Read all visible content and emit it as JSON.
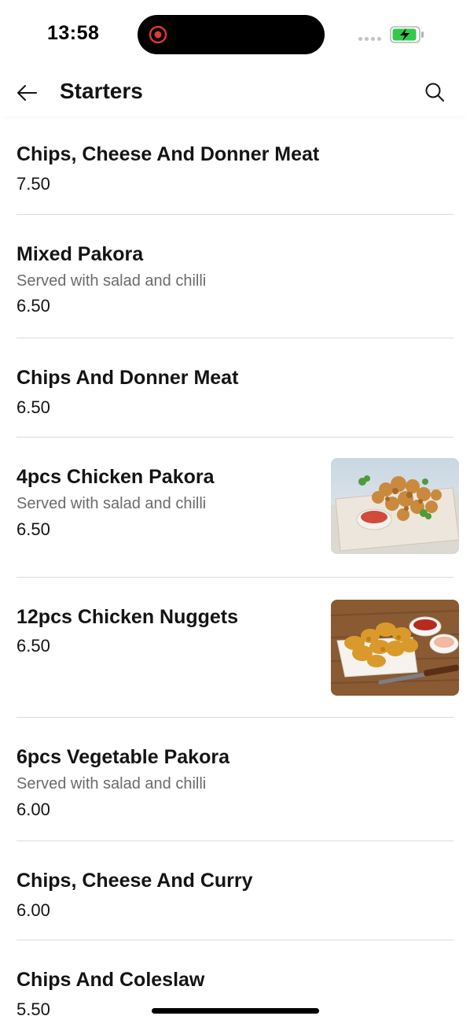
{
  "status_bar": {
    "time": "13:58"
  },
  "header": {
    "title": "Starters"
  },
  "colors": {
    "text": "#141414",
    "secondary_text": "#6b6b6b",
    "divider": "#dcdcdc",
    "battery_green": "#32c94c",
    "record_red": "#e03b2f"
  },
  "menu": {
    "items": [
      {
        "name": "Chips, Cheese And Donner Meat",
        "description": "",
        "price": "7.50",
        "image": ""
      },
      {
        "name": "Mixed Pakora",
        "description": "Served with salad and chilli",
        "price": "6.50",
        "image": ""
      },
      {
        "name": "Chips And Donner Meat",
        "description": "",
        "price": "6.50",
        "image": ""
      },
      {
        "name": "4pcs Chicken Pakora",
        "description": "Served with salad and chilli",
        "price": "6.50",
        "image": "chicken-pakora-photo"
      },
      {
        "name": "12pcs Chicken Nuggets",
        "description": "",
        "price": "6.50",
        "image": "chicken-nuggets-photo"
      },
      {
        "name": "6pcs Vegetable Pakora",
        "description": "Served with salad and chilli",
        "price": "6.00",
        "image": ""
      },
      {
        "name": "Chips, Cheese And Curry",
        "description": "",
        "price": "6.00",
        "image": ""
      },
      {
        "name": "Chips And Coleslaw",
        "description": "",
        "price": "5.50",
        "image": ""
      }
    ]
  }
}
